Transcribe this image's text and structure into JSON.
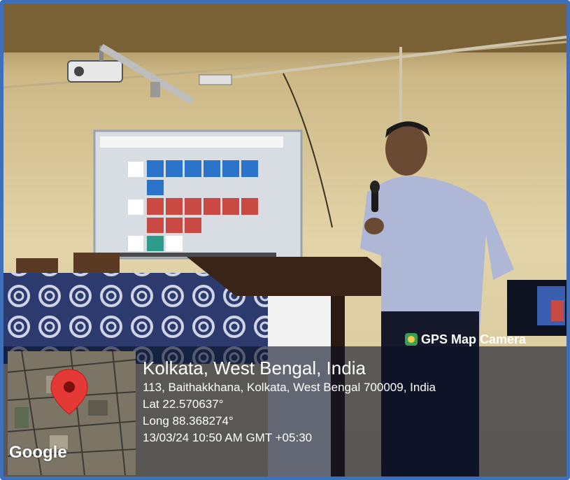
{
  "overlay": {
    "brand": "GPS Map Camera",
    "title": "Kolkata, West Bengal, India",
    "address": "113, Baithakkhana, Kolkata, West Bengal 700009, India",
    "lat": "Lat 22.570637°",
    "long": "Long 88.368274°",
    "datetime": "13/03/24 10:50 AM GMT +05:30",
    "map_logo": "Google"
  },
  "colors": {
    "frame_border": "#3e6fb8",
    "wall": "#d9c9a0",
    "overlay_bg": "#0c1226",
    "pin": "#e53935"
  },
  "icons": [
    "gps-map-camera-icon",
    "map-pin-icon"
  ]
}
